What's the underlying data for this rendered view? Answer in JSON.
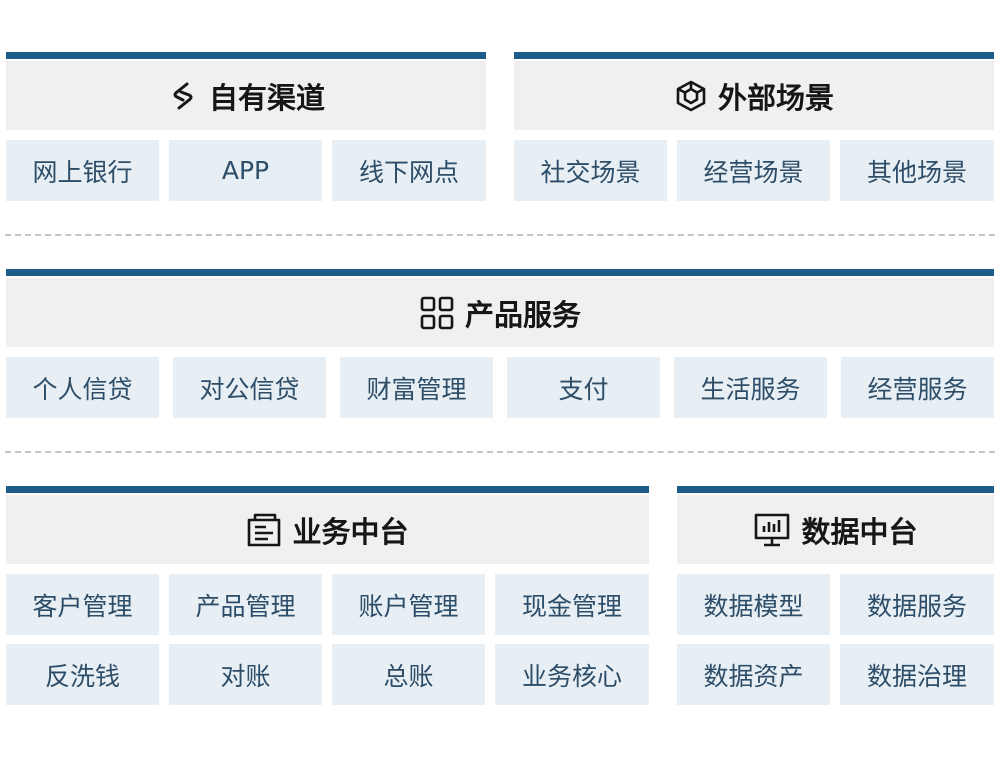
{
  "channels": {
    "title": "自有渠道",
    "icon": "link-icon",
    "items": [
      "网上银行",
      "APP",
      "线下网点"
    ]
  },
  "external": {
    "title": "外部场景",
    "icon": "cube-icon",
    "items": [
      "社交场景",
      "经营场景",
      "其他场景"
    ]
  },
  "products": {
    "title": "产品服务",
    "icon": "grid-icon",
    "items": [
      "个人信贷",
      "对公信贷",
      "财富管理",
      "支付",
      "生活服务",
      "经营服务"
    ]
  },
  "business": {
    "title": "业务中台",
    "icon": "document-icon",
    "items": [
      "客户管理",
      "产品管理",
      "账户管理",
      "现金管理",
      "反洗钱",
      "对账",
      "总账",
      "业务核心"
    ]
  },
  "data": {
    "title": "数据中台",
    "icon": "monitor-chart-icon",
    "items": [
      "数据模型",
      "数据服务",
      "数据资产",
      "数据治理"
    ]
  },
  "colors": {
    "accent_bar": "#1e5b88",
    "header_bg": "#f0f0f0",
    "tile_bg": "#e7eff5",
    "tile_text": "#2d4d68"
  }
}
